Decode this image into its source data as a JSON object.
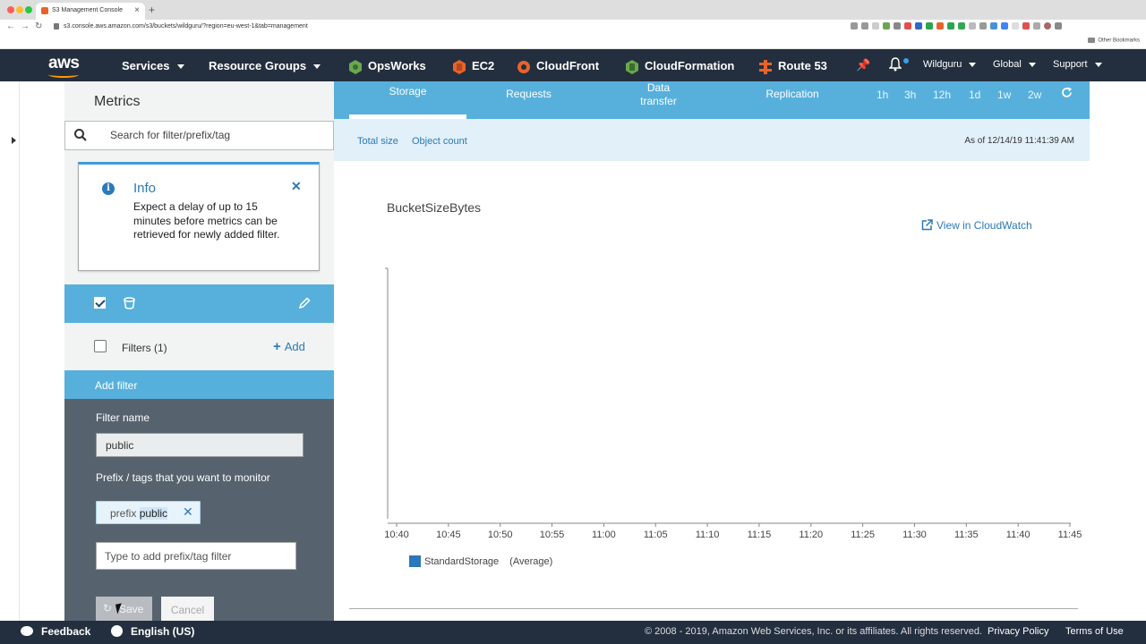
{
  "browser": {
    "tab_title": "S3 Management Console",
    "url": "s3.console.aws.amazon.com/s3/buckets/wildguru/?region=eu-west-1&tab=management",
    "bookmarks_label": "Other Bookmarks"
  },
  "awsnav": {
    "logo": "aws",
    "services": "Services",
    "resource_groups": "Resource Groups",
    "shortcuts": [
      {
        "label": "OpsWorks",
        "color": "#6aa84f"
      },
      {
        "label": "EC2",
        "color": "#e8632b"
      },
      {
        "label": "CloudFront",
        "color": "#e8632b"
      },
      {
        "label": "CloudFormation",
        "color": "#6aa84f"
      },
      {
        "label": "Route 53",
        "color": "#e8632b"
      }
    ],
    "account": "Wildguru",
    "region": "Global",
    "support": "Support"
  },
  "metrics": {
    "title": "Metrics",
    "search_placeholder": "Search for filter/prefix/tag",
    "info_title": "Info",
    "info_text": "Expect a delay of up to 15 minutes before metrics can be retrieved for newly added filter.",
    "filters_label": "Filters (1)",
    "add_label": "Add",
    "add_filter_header": "Add filter",
    "filter_name_label": "Filter name",
    "filter_name_value": "public",
    "prefix_label": "Prefix / tags that you want to monitor",
    "chip_key": "prefix",
    "chip_value": "public",
    "tag_placeholder": "Type to add prefix/tag filter",
    "save_label": "Save",
    "cancel_label": "Cancel"
  },
  "tabs": {
    "storage": "Storage",
    "requests": "Requests",
    "data_transfer_1": "Data",
    "data_transfer_2": "transfer",
    "replication": "Replication",
    "ranges": [
      "1h",
      "3h",
      "12h",
      "1d",
      "1w",
      "2w"
    ]
  },
  "subtabs": {
    "total_size": "Total size",
    "object_count": "Object count",
    "as_of": "As of 12/14/19 11:41:39 AM"
  },
  "chart_link": "View in CloudWatch",
  "chart_data": {
    "type": "line",
    "title": "BucketSizeBytes",
    "x": [
      "10:40",
      "10:45",
      "10:50",
      "10:55",
      "11:00",
      "11:05",
      "11:10",
      "11:15",
      "11:20",
      "11:25",
      "11:30",
      "11:35",
      "11:40",
      "11:45"
    ],
    "series": [
      {
        "name": "StandardStorage",
        "values": []
      }
    ],
    "legend_suffix": "(Average)",
    "series_color": "#2a78b8",
    "grid": false,
    "legend_position": "bottom-left"
  },
  "footer": {
    "feedback": "Feedback",
    "language": "English (US)",
    "copyright": "© 2008 - 2019, Amazon Web Services, Inc. or its affiliates. All rights reserved.",
    "privacy": "Privacy Policy",
    "terms": "Terms of Use"
  }
}
